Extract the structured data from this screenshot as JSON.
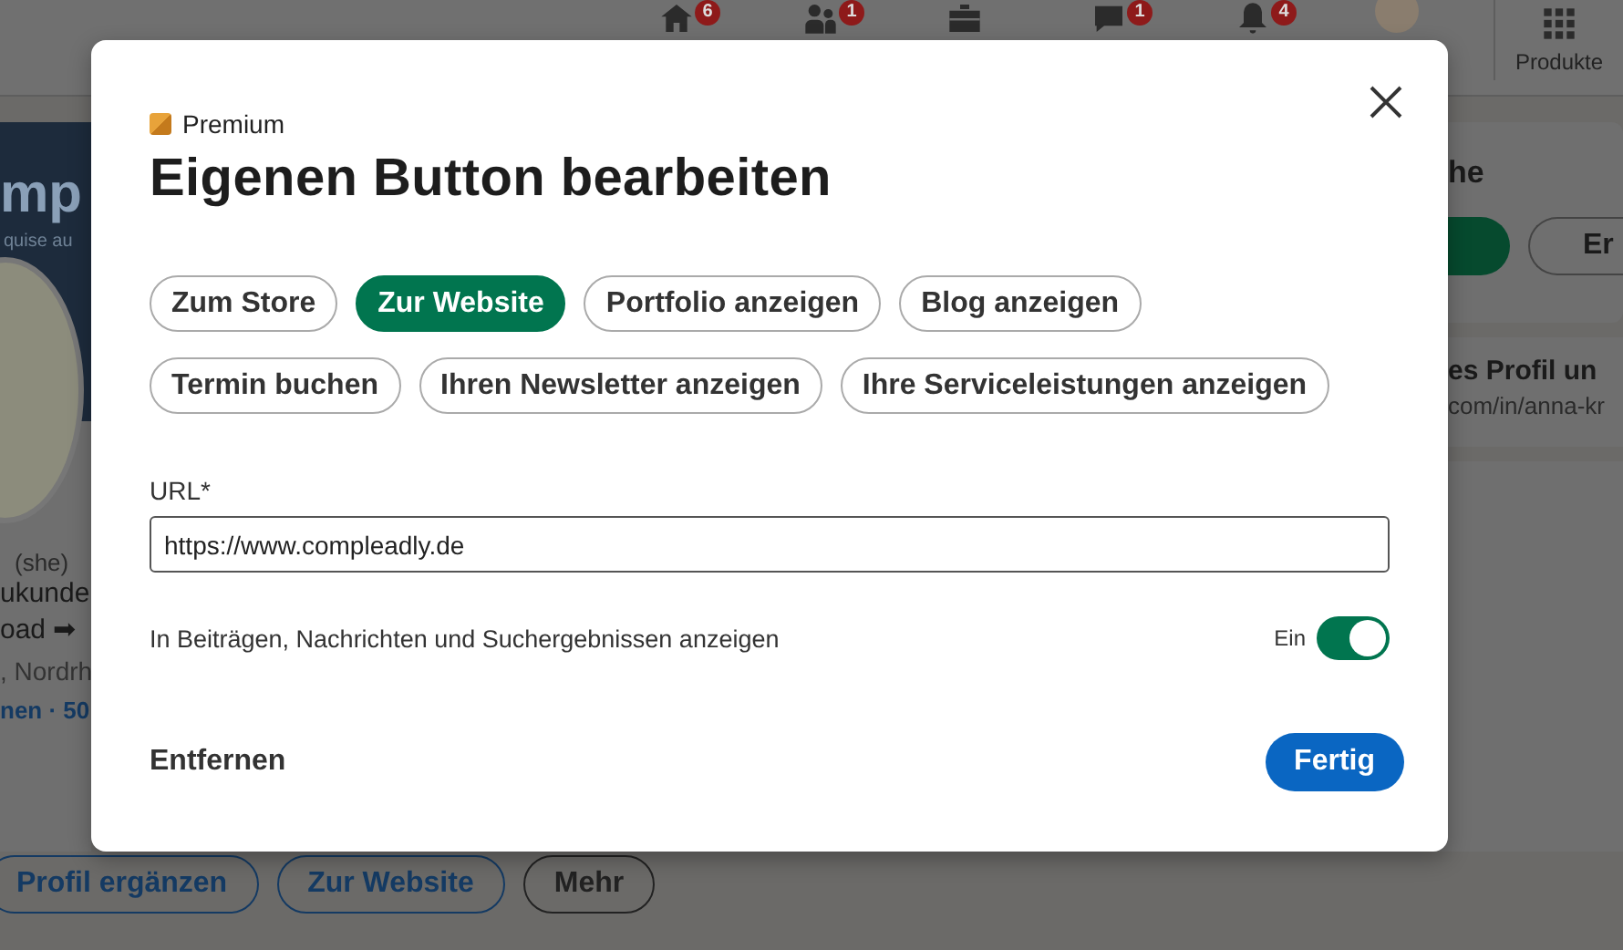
{
  "top_nav": {
    "items": [
      {
        "kind": "home",
        "badge": "6"
      },
      {
        "kind": "network",
        "badge": "1"
      },
      {
        "kind": "jobs"
      },
      {
        "kind": "messaging",
        "badge": "1"
      },
      {
        "kind": "notifications",
        "badge": "4"
      },
      {
        "kind": "avatar"
      },
      {
        "kind": "grid",
        "label": "Produkte"
      }
    ]
  },
  "profile_card": {
    "banner_text": "mp",
    "banner_subtext": "quise au",
    "pronouns": "(she)",
    "headline_lines": [
      "ukunde",
      "oad ➡"
    ],
    "location": ", Nordrh",
    "contact": "nen · 50",
    "actions": [
      {
        "label": "Profil ergänzen",
        "kind": "accent"
      },
      {
        "label": "Zur Website",
        "kind": "accent"
      },
      {
        "label": "Mehr",
        "kind": "neutral"
      }
    ]
  },
  "right_panel": {
    "heading": "he",
    "pills": [
      {
        "kind": "filled"
      },
      {
        "kind": "outline",
        "label": "Er"
      }
    ],
    "profile_title": "es Profil un",
    "profile_url": "com/in/anna-kr"
  },
  "dialog": {
    "badge": "Premium",
    "title": "Eigenen Button bearbeiten",
    "options": [
      {
        "label": "Zum Store",
        "selected": false
      },
      {
        "label": "Zur Website",
        "selected": true
      },
      {
        "label": "Portfolio anzeigen",
        "selected": false
      },
      {
        "label": "Blog anzeigen",
        "selected": false
      },
      {
        "label": "Termin buchen",
        "selected": false
      },
      {
        "label": "Ihren Newsletter anzeigen",
        "selected": false
      },
      {
        "label": "Ihre Serviceleistungen anzeigen",
        "selected": false
      }
    ],
    "url": {
      "label": "URL*",
      "value": "https://www.compleadly.de"
    },
    "toggle": {
      "label": "In Beiträgen, Nachrichten und Suchergebnissen anzeigen",
      "state_label": "Ein",
      "on": true
    },
    "remove": "Entfernen",
    "done": "Fertig"
  }
}
